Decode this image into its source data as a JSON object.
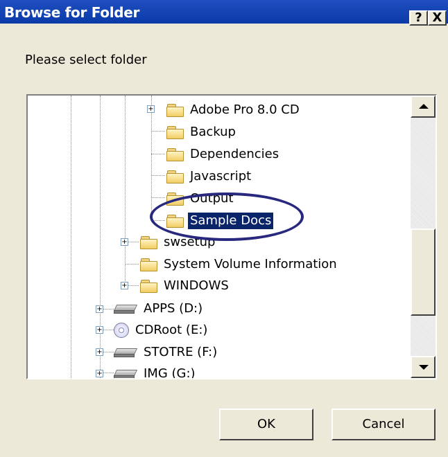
{
  "window": {
    "title": "Browse for Folder",
    "help_label": "?",
    "close_label": "X"
  },
  "dialog": {
    "prompt": "Please select folder"
  },
  "tree": {
    "folders": [
      {
        "label": "Adobe Pro 8.0 CD",
        "expander": "+"
      },
      {
        "label": "Backup"
      },
      {
        "label": "Dependencies"
      },
      {
        "label": "Javascript"
      },
      {
        "label": "Output"
      },
      {
        "label": "Sample Docs",
        "selected": true
      },
      {
        "label": "swsetup",
        "expander": "+"
      },
      {
        "label": "System Volume Information"
      },
      {
        "label": "WINDOWS",
        "expander": "+"
      }
    ],
    "drives": [
      {
        "label": "APPS (D:)",
        "icon": "hard-drive-icon",
        "expander": "+"
      },
      {
        "label": "CDRoot (E:)",
        "icon": "cd-drive-icon",
        "expander": "+"
      },
      {
        "label": "STOTRE (F:)",
        "icon": "hard-drive-icon",
        "expander": "+"
      },
      {
        "label": "IMG (G:)",
        "icon": "hard-drive-icon",
        "expander": "+"
      }
    ]
  },
  "buttons": {
    "ok": "OK",
    "cancel": "Cancel"
  },
  "colors": {
    "titlebar": "#0a3aa8",
    "selection": "#0a246a",
    "annotation_ellipse": "#27287e"
  }
}
